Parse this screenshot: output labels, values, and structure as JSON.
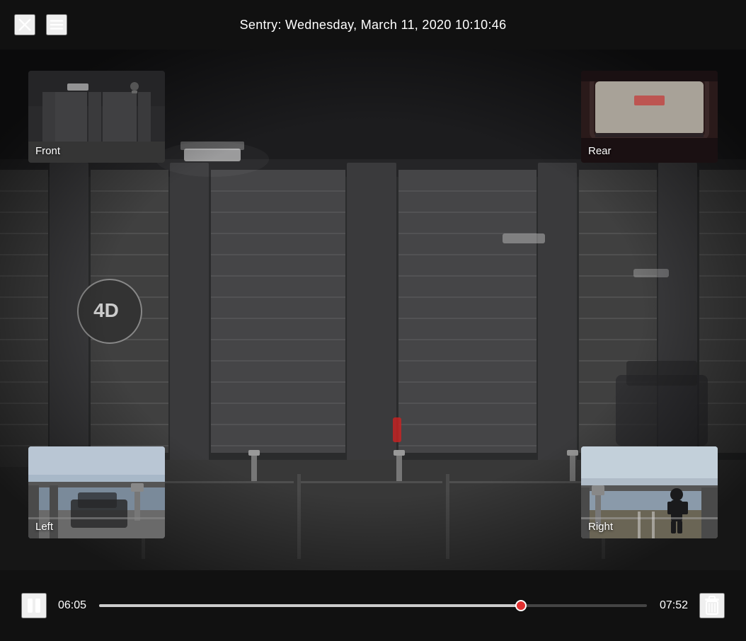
{
  "header": {
    "title": "Sentry: Wednesday, March 11, 2020 10:10:46",
    "close_label": "×",
    "menu_label": "≡"
  },
  "thumbnails": {
    "front": {
      "label": "Front",
      "position": "top-left"
    },
    "rear": {
      "label": "Rear",
      "position": "top-right"
    },
    "left": {
      "label": "Left",
      "position": "bottom-left"
    },
    "right": {
      "label": "Right",
      "position": "bottom-right"
    }
  },
  "controls": {
    "time_current": "06:05",
    "time_total": "07:52",
    "progress": 0.77,
    "play_icon": "pause",
    "delete_label": "delete"
  }
}
